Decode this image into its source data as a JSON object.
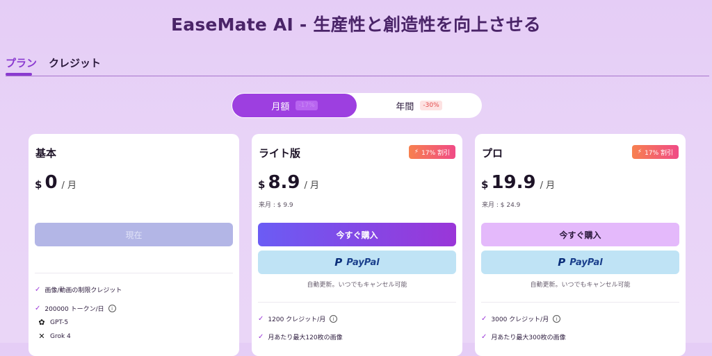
{
  "page": {
    "title": "EaseMate AI - 生産性と創造性を向上させる"
  },
  "tabs": [
    {
      "label": "プラン",
      "active": true
    },
    {
      "label": "クレジット",
      "active": false
    }
  ],
  "billing_toggle": {
    "monthly": {
      "label": "月額",
      "discount": "-17%",
      "selected": true
    },
    "yearly": {
      "label": "年間",
      "discount": "-30%",
      "selected": false
    }
  },
  "plans": [
    {
      "name": "基本",
      "currency": "$",
      "price": "0",
      "per": "/ 月",
      "button": "現在",
      "features": [
        "画像/動画の制限クレジット",
        "200000 トークン/日"
      ],
      "models": [
        {
          "icon": "openai-icon",
          "label": "GPT-5"
        },
        {
          "icon": "grok-icon",
          "label": "Grok 4"
        }
      ]
    },
    {
      "name": "ライト版",
      "badge": "17% 割引",
      "currency": "$",
      "price": "8.9",
      "per": "/ 月",
      "next_price": "来月 : $ 9.9",
      "button": "今すぐ購入",
      "paypal": "PayPal",
      "auto_renew": "自動更新。いつでもキャンセル可能",
      "features": [
        "1200 クレジット/月",
        "月あたり最大120枚の画像"
      ]
    },
    {
      "name": "プロ",
      "badge": "17% 割引",
      "currency": "$",
      "price": "19.9",
      "per": "/ 月",
      "next_price": "来月 : $ 24.9",
      "button": "今すぐ購入",
      "paypal": "PayPal",
      "auto_renew": "自動更新。いつでもキャンセル可能",
      "features": [
        "3000 クレジット/月",
        "月あたり最大300枚の画像"
      ]
    }
  ],
  "colors": {
    "accent": "#9d3fe0",
    "badge_from": "#f7804f",
    "badge_to": "#f04b86",
    "paypal_bg": "#bfe3f5"
  }
}
